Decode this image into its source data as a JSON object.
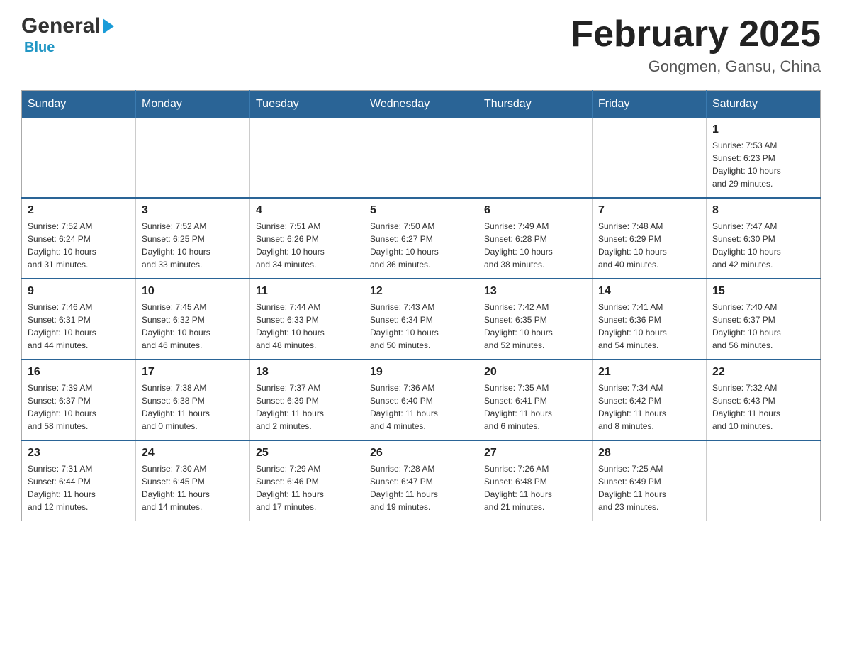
{
  "header": {
    "logo_general": "General",
    "logo_blue": "Blue",
    "month_title": "February 2025",
    "location": "Gongmen, Gansu, China"
  },
  "weekdays": [
    "Sunday",
    "Monday",
    "Tuesday",
    "Wednesday",
    "Thursday",
    "Friday",
    "Saturday"
  ],
  "weeks": [
    [
      {
        "day": "",
        "info": ""
      },
      {
        "day": "",
        "info": ""
      },
      {
        "day": "",
        "info": ""
      },
      {
        "day": "",
        "info": ""
      },
      {
        "day": "",
        "info": ""
      },
      {
        "day": "",
        "info": ""
      },
      {
        "day": "1",
        "info": "Sunrise: 7:53 AM\nSunset: 6:23 PM\nDaylight: 10 hours\nand 29 minutes."
      }
    ],
    [
      {
        "day": "2",
        "info": "Sunrise: 7:52 AM\nSunset: 6:24 PM\nDaylight: 10 hours\nand 31 minutes."
      },
      {
        "day": "3",
        "info": "Sunrise: 7:52 AM\nSunset: 6:25 PM\nDaylight: 10 hours\nand 33 minutes."
      },
      {
        "day": "4",
        "info": "Sunrise: 7:51 AM\nSunset: 6:26 PM\nDaylight: 10 hours\nand 34 minutes."
      },
      {
        "day": "5",
        "info": "Sunrise: 7:50 AM\nSunset: 6:27 PM\nDaylight: 10 hours\nand 36 minutes."
      },
      {
        "day": "6",
        "info": "Sunrise: 7:49 AM\nSunset: 6:28 PM\nDaylight: 10 hours\nand 38 minutes."
      },
      {
        "day": "7",
        "info": "Sunrise: 7:48 AM\nSunset: 6:29 PM\nDaylight: 10 hours\nand 40 minutes."
      },
      {
        "day": "8",
        "info": "Sunrise: 7:47 AM\nSunset: 6:30 PM\nDaylight: 10 hours\nand 42 minutes."
      }
    ],
    [
      {
        "day": "9",
        "info": "Sunrise: 7:46 AM\nSunset: 6:31 PM\nDaylight: 10 hours\nand 44 minutes."
      },
      {
        "day": "10",
        "info": "Sunrise: 7:45 AM\nSunset: 6:32 PM\nDaylight: 10 hours\nand 46 minutes."
      },
      {
        "day": "11",
        "info": "Sunrise: 7:44 AM\nSunset: 6:33 PM\nDaylight: 10 hours\nand 48 minutes."
      },
      {
        "day": "12",
        "info": "Sunrise: 7:43 AM\nSunset: 6:34 PM\nDaylight: 10 hours\nand 50 minutes."
      },
      {
        "day": "13",
        "info": "Sunrise: 7:42 AM\nSunset: 6:35 PM\nDaylight: 10 hours\nand 52 minutes."
      },
      {
        "day": "14",
        "info": "Sunrise: 7:41 AM\nSunset: 6:36 PM\nDaylight: 10 hours\nand 54 minutes."
      },
      {
        "day": "15",
        "info": "Sunrise: 7:40 AM\nSunset: 6:37 PM\nDaylight: 10 hours\nand 56 minutes."
      }
    ],
    [
      {
        "day": "16",
        "info": "Sunrise: 7:39 AM\nSunset: 6:37 PM\nDaylight: 10 hours\nand 58 minutes."
      },
      {
        "day": "17",
        "info": "Sunrise: 7:38 AM\nSunset: 6:38 PM\nDaylight: 11 hours\nand 0 minutes."
      },
      {
        "day": "18",
        "info": "Sunrise: 7:37 AM\nSunset: 6:39 PM\nDaylight: 11 hours\nand 2 minutes."
      },
      {
        "day": "19",
        "info": "Sunrise: 7:36 AM\nSunset: 6:40 PM\nDaylight: 11 hours\nand 4 minutes."
      },
      {
        "day": "20",
        "info": "Sunrise: 7:35 AM\nSunset: 6:41 PM\nDaylight: 11 hours\nand 6 minutes."
      },
      {
        "day": "21",
        "info": "Sunrise: 7:34 AM\nSunset: 6:42 PM\nDaylight: 11 hours\nand 8 minutes."
      },
      {
        "day": "22",
        "info": "Sunrise: 7:32 AM\nSunset: 6:43 PM\nDaylight: 11 hours\nand 10 minutes."
      }
    ],
    [
      {
        "day": "23",
        "info": "Sunrise: 7:31 AM\nSunset: 6:44 PM\nDaylight: 11 hours\nand 12 minutes."
      },
      {
        "day": "24",
        "info": "Sunrise: 7:30 AM\nSunset: 6:45 PM\nDaylight: 11 hours\nand 14 minutes."
      },
      {
        "day": "25",
        "info": "Sunrise: 7:29 AM\nSunset: 6:46 PM\nDaylight: 11 hours\nand 17 minutes."
      },
      {
        "day": "26",
        "info": "Sunrise: 7:28 AM\nSunset: 6:47 PM\nDaylight: 11 hours\nand 19 minutes."
      },
      {
        "day": "27",
        "info": "Sunrise: 7:26 AM\nSunset: 6:48 PM\nDaylight: 11 hours\nand 21 minutes."
      },
      {
        "day": "28",
        "info": "Sunrise: 7:25 AM\nSunset: 6:49 PM\nDaylight: 11 hours\nand 23 minutes."
      },
      {
        "day": "",
        "info": ""
      }
    ]
  ]
}
